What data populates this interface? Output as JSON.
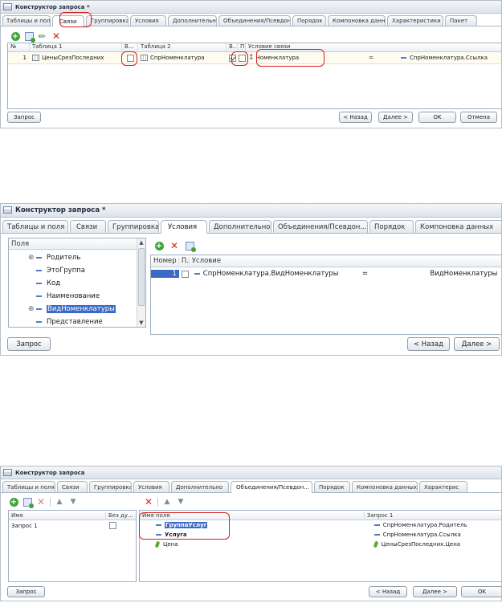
{
  "panel1": {
    "title": "Конструктор запроса *",
    "tabs": [
      "Таблицы и поля",
      "Связи",
      "Группировка",
      "Условия",
      "Дополнительно",
      "Объединения/Псевдон...",
      "Порядок",
      "Компоновка данных",
      "Характеристики",
      "Пакет"
    ],
    "columns": {
      "no": "№",
      "table1": "Таблица 1",
      "all1": "В...",
      "table2": "Таблица 2",
      "all2": "В...",
      "p": "П...",
      "condition": "Условие связи"
    },
    "row": {
      "no": "1",
      "table1": "ЦеныСрезПоследних",
      "table2": "СпрНоменклатура",
      "field": "Номенклатура",
      "op": "=",
      "value": "СпрНоменклатура.Ссылка"
    },
    "buttons": {
      "query": "Запрос",
      "back": "< Назад",
      "next": "Далее >",
      "ok": "OK",
      "cancel": "Отмена"
    }
  },
  "panel2": {
    "title": "Конструктор запроса *",
    "tabs": [
      "Таблицы и поля",
      "Связи",
      "Группировка",
      "Условия",
      "Дополнительно",
      "Объединения/Псевдон...",
      "Порядок",
      "Компоновка данных"
    ],
    "fields_header": "Поля",
    "fields": [
      "Родитель",
      "ЭтоГруппа",
      "Код",
      "Наименование",
      "ВидНоменклатуры",
      "Представление"
    ],
    "columns": {
      "no": "Номер",
      "p": "П...",
      "condition": "Условие"
    },
    "row": {
      "no": "1",
      "field": "СпрНоменклатура.ВидНоменклатуры",
      "op": "=",
      "value": "ВидНоменклатуры"
    },
    "buttons": {
      "query": "Запрос",
      "back": "< Назад",
      "next": "Далее >"
    }
  },
  "panel3": {
    "title": "Конструктор запроса",
    "tabs": [
      "Таблицы и поля",
      "Связи",
      "Группировка",
      "Условия",
      "Дополнительно",
      "Объединения/Псевдон...",
      "Порядок",
      "Компоновка данных",
      "Характерис"
    ],
    "left_columns": {
      "name": "Имя",
      "nodup": "Без ду..."
    },
    "left_row": {
      "name": "Запрос 1"
    },
    "right_columns": {
      "field": "Имя поля",
      "query1": "Запрос 1"
    },
    "rows": [
      {
        "name": "ГруппаУслуг",
        "query": "СпрНоменклатура.Родитель"
      },
      {
        "name": "Услуга",
        "query": "СпрНоменклатура.Ссылка"
      },
      {
        "name": "Цена",
        "query": "ЦеныСрезПоследних.Цена"
      }
    ],
    "buttons": {
      "query": "Запрос",
      "back": "< Назад",
      "next": "Далее >",
      "ok": "OK"
    }
  },
  "colors": {
    "highlight": "#d61f1f",
    "selection": "#3a6ac6",
    "border": "#9fb0c2"
  }
}
